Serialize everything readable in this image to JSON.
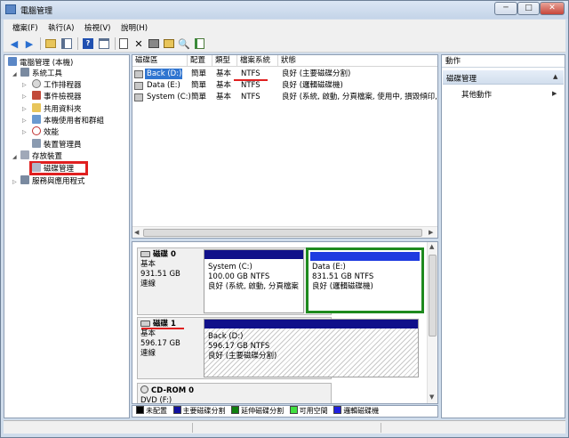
{
  "window": {
    "title": "電腦管理",
    "min_glyph": "─",
    "max_glyph": "□",
    "close_glyph": "✕"
  },
  "menu": [
    "檔案(F)",
    "執行(A)",
    "檢視(V)",
    "說明(H)"
  ],
  "tree": {
    "root": "電腦管理 (本機)",
    "system_tools": "系統工具",
    "task_scheduler": "工作排程器",
    "event_viewer": "事件檢視器",
    "shared_folders": "共用資料夾",
    "local_users": "本機使用者和群組",
    "performance": "效能",
    "device_manager": "裝置管理員",
    "storage": "存放裝置",
    "disk_management": "磁碟管理",
    "services": "服務與應用程式"
  },
  "volume_list": {
    "columns": [
      "磁碟區",
      "配置",
      "類型",
      "檔案系統",
      "狀態"
    ],
    "rows": [
      {
        "name": "Back (D:)",
        "layout": "簡單",
        "type": "基本",
        "fs": "NTFS",
        "status": "良好 (主要磁碟分割)"
      },
      {
        "name": "Data (E:)",
        "layout": "簡單",
        "type": "基本",
        "fs": "NTFS",
        "status": "良好 (邏輯磁碟機)"
      },
      {
        "name": "System (C:)",
        "layout": "簡單",
        "type": "基本",
        "fs": "NTFS",
        "status": "良好 (系統, 啟動, 分頁檔案, 使用中, 損毀傾印, 主要磁碟分割)"
      }
    ]
  },
  "disks": [
    {
      "label": "磁碟 0",
      "type": "基本",
      "size": "931.51 GB",
      "state": "連線",
      "partitions": [
        {
          "name": "System  (C:)",
          "size": "100.00 GB NTFS",
          "status": "良好 (系統, 啟動, 分頁檔案"
        },
        {
          "name": "Data  (E:)",
          "size": "831.51 GB NTFS",
          "status": "良好 (邏輯磁碟機)"
        }
      ]
    },
    {
      "label": "磁碟 1",
      "type": "基本",
      "size": "596.17 GB",
      "state": "連線",
      "partitions": [
        {
          "name": "Back  (D:)",
          "size": "596.17 GB NTFS",
          "status": "良好 (主要磁碟分割)"
        }
      ]
    },
    {
      "label": "CD-ROM 0",
      "type": "DVD (F:)"
    }
  ],
  "legend": [
    {
      "label": "未配置",
      "color": "#000000"
    },
    {
      "label": "主要磁碟分割",
      "color": "#1010a0"
    },
    {
      "label": "延伸磁碟分割",
      "color": "#108010"
    },
    {
      "label": "可用空間",
      "color": "#40e040"
    },
    {
      "label": "邏輯磁碟機",
      "color": "#2020e0"
    }
  ],
  "actions": {
    "header": "動作",
    "section": "磁碟管理",
    "more": "其他動作"
  },
  "colors": {
    "accent": "#10108a",
    "logical_drive_border": "#1e8a1e",
    "annotation": "#e02020"
  }
}
